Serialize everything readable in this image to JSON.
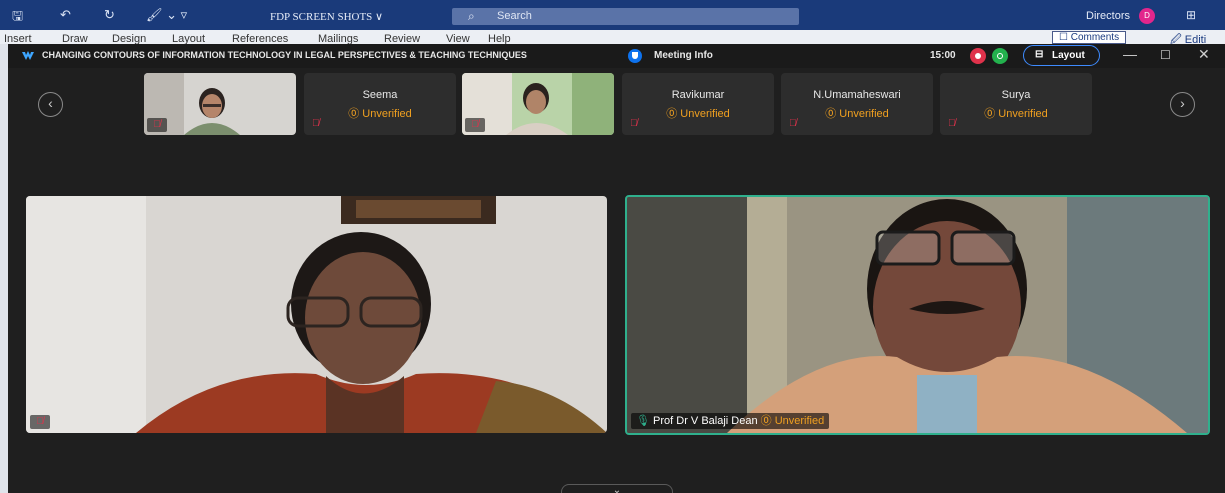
{
  "word": {
    "doc_title": "FDP SCREEN SHOTS ∨",
    "search_placeholder": "Search",
    "account_name": "Directors",
    "account_initial": "D",
    "ribbon_tabs": [
      "Insert",
      "Draw",
      "Design",
      "Layout",
      "References",
      "Mailings",
      "Review",
      "View",
      "Help"
    ],
    "comments_label": "☐ Comments",
    "editing_label": "🖉 Editi"
  },
  "zoom": {
    "meeting_title": "CHANGING CONTOURS OF INFORMATION TECHNOLOGY IN LEGAL PERSPECTIVES & TEACHING TECHNIQUES",
    "meeting_info_label": "Meeting Info",
    "elapsed_time": "15:00",
    "layout_label": "Layout",
    "thumbnails": [
      {
        "name": "Seema",
        "status": "Unverified"
      },
      {
        "name": "Ravikumar",
        "status": "Unverified"
      },
      {
        "name": "N.Umamaheswari",
        "status": "Unverified"
      },
      {
        "name": "Surya",
        "status": "Unverified"
      }
    ],
    "speaker_name": "Prof Dr V Balaji Dean",
    "speaker_status": "Unverified",
    "unverified_glyph": "⓪",
    "mute_glyph": "🎙̸"
  },
  "colors": {
    "zoom_bg": "#1f1f1f",
    "tile_bg": "#2d2d2d",
    "unverified": "#f0a020",
    "active_speaker_border": "#2fb08d",
    "word_titlebar": "#1a3a7a",
    "record": "#e0324b",
    "live": "#23b14d",
    "layout_outline": "#3e8bff"
  }
}
